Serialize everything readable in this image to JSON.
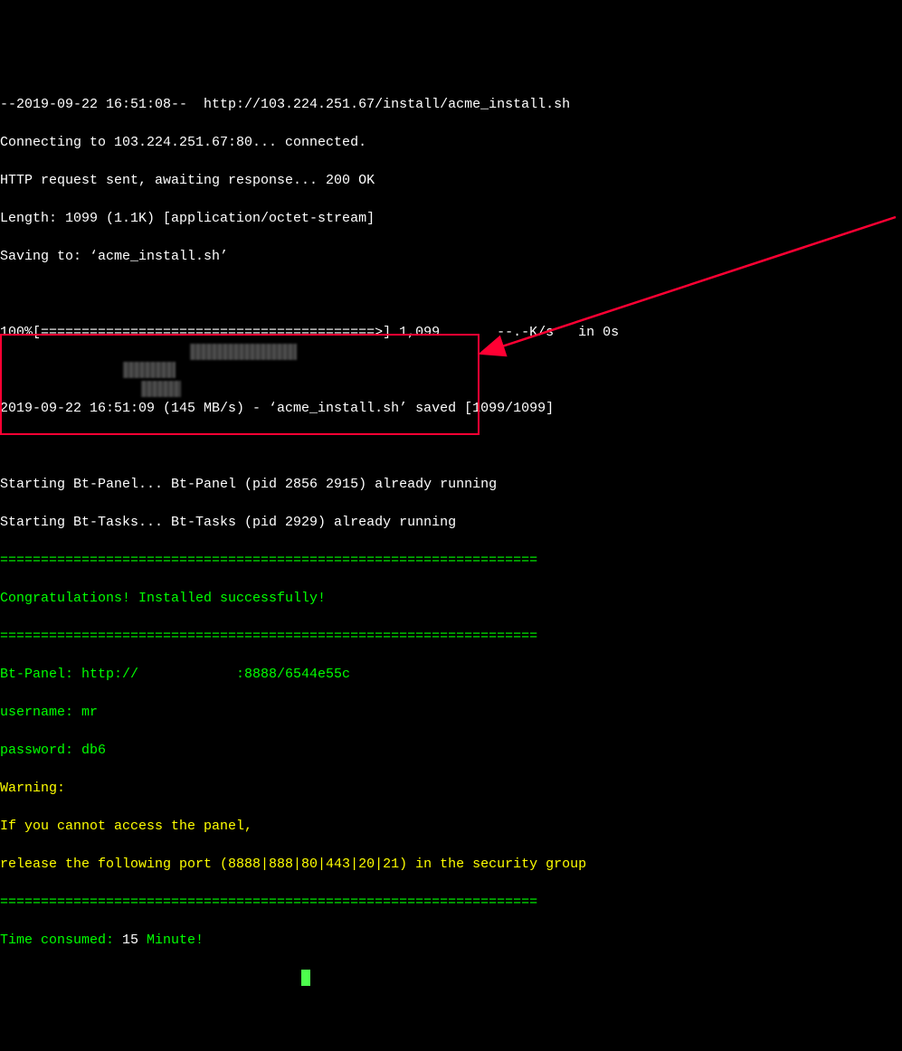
{
  "lines": {
    "l0": "--2019-09-22 16:51:08--  http://103.224.251.67/install/acme_install.sh",
    "l1": "Connecting to 103.224.251.67:80... connected.",
    "l2": "HTTP request sent, awaiting response... 200 OK",
    "l3": "Length: 1099 (1.1K) [application/octet-stream]",
    "l4": "Saving to: ‘acme_install.sh’",
    "l5": "",
    "l6": "100%[=========================================>] 1,099       --.-K/s   in 0s",
    "l7": "",
    "l8": "2019-09-22 16:51:09 (145 MB/s) - ‘acme_install.sh’ saved [1099/1099]",
    "l9": "",
    "l10": "Starting Bt-Panel... Bt-Panel (pid 2856 2915) already running",
    "l11": "Starting Bt-Tasks... Bt-Tasks (pid 2929) already running",
    "l12": "==================================================================",
    "l13": "Congratulations! Installed successfully!",
    "l14": "==================================================================",
    "l15": "Bt-Panel: http://            :8888/6544e55c",
    "l16": "username: mr",
    "l17": "password: db6",
    "l18": "Warning:",
    "l19": "If you cannot access the panel, ",
    "l20": "release the following port (8888|888|80|443|20|21) in the security group",
    "l21": "==================================================================",
    "l22_prefix": "Time consumed: ",
    "l22_time": "15",
    "l22_suffix": " Minute!"
  }
}
